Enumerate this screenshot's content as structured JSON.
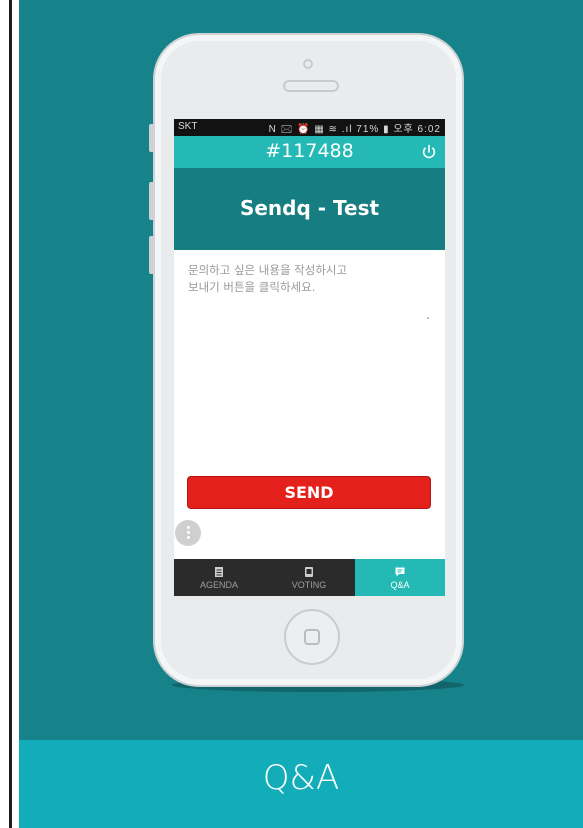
{
  "caption": {
    "label": "Q&A"
  },
  "status_bar": {
    "carrier": "SKT",
    "indicators": "N 🖂 ⏰ ▦ ≋ .ıl 71% ▮ 오후 6:02"
  },
  "app": {
    "session_id": "#117488",
    "power_icon": "power-icon",
    "event_title": "Sendq - Test",
    "question_placeholder": "문의하고 싶은 내용을 작성하시고\n보내기 버튼을 클릭하세요.",
    "send_label": "SEND",
    "more_icon": "more-vertical-icon"
  },
  "tabs": [
    {
      "label": "AGENDA",
      "icon": "agenda-icon",
      "active": false
    },
    {
      "label": "VOTING",
      "icon": "voting-icon",
      "active": false
    },
    {
      "label": "Q&A",
      "icon": "chat-icon",
      "active": true
    }
  ],
  "colors": {
    "stage_bg": "#16828a",
    "caption_bg": "#13adba",
    "app_accent": "#25b9b5",
    "title_bar": "#167e80",
    "send_button": "#e4201c",
    "tab_bar": "#2b2b2b"
  }
}
